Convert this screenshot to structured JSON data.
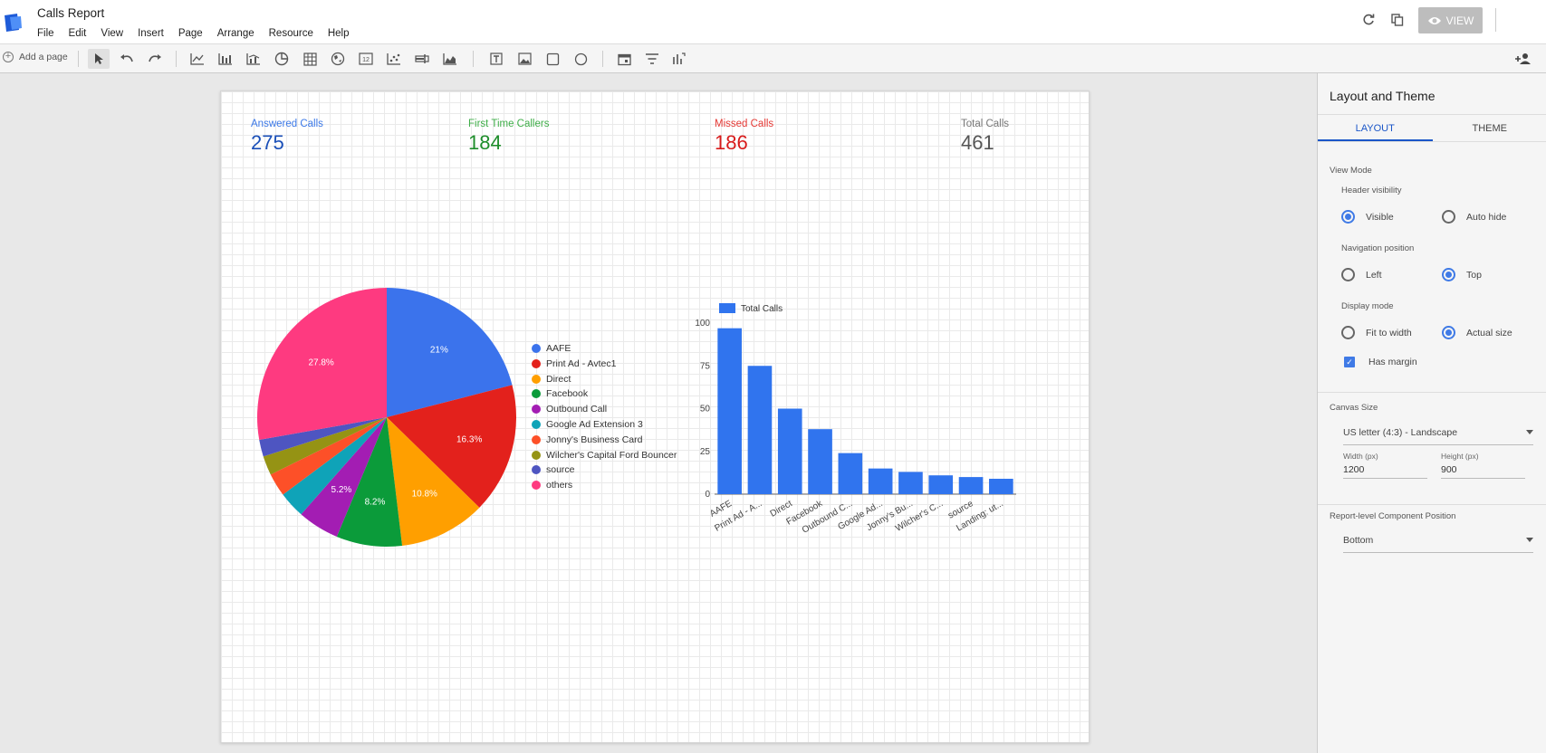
{
  "header": {
    "title": "Calls Report",
    "menu": [
      "File",
      "Edit",
      "View",
      "Insert",
      "Page",
      "Arrange",
      "Resource",
      "Help"
    ],
    "view_label": "VIEW"
  },
  "toolbar": {
    "add_page": "Add a page"
  },
  "kpis": [
    {
      "label": "Answered Calls",
      "value": "275",
      "color": "#3b78e7",
      "value_color": "#1a4fb8"
    },
    {
      "label": "First Time Callers",
      "value": "184",
      "color": "#3fae49",
      "value_color": "#1e8e2b"
    },
    {
      "label": "Missed Calls",
      "value": "186",
      "color": "#e53935",
      "value_color": "#d81b1b"
    },
    {
      "label": "Total Calls",
      "value": "461",
      "color": "#777777",
      "value_color": "#555555"
    }
  ],
  "chart_data": [
    {
      "type": "pie",
      "slices": [
        {
          "name": "AAFE",
          "value": 21.0,
          "label": "21%",
          "color": "#3b73ec"
        },
        {
          "name": "Print Ad - Avtec1",
          "value": 16.3,
          "label": "16.3%",
          "color": "#e3211c"
        },
        {
          "name": "Direct",
          "value": 10.8,
          "label": "10.8%",
          "color": "#ff9f00"
        },
        {
          "name": "Facebook",
          "value": 8.2,
          "label": "8.2%",
          "color": "#0b9b3a"
        },
        {
          "name": "Outbound Call",
          "value": 5.2,
          "label": "5.2%",
          "color": "#a31db3"
        },
        {
          "name": "Google Ad Extension 3",
          "value": 3.3,
          "label": "",
          "color": "#0fa3b8"
        },
        {
          "name": "Jonny's Business Card",
          "value": 2.9,
          "label": "",
          "color": "#fd5028"
        },
        {
          "name": "Wilcher's Capital Ford Bouncer",
          "value": 2.4,
          "label": "",
          "color": "#959314"
        },
        {
          "name": "source",
          "value": 2.1,
          "label": "",
          "color": "#4e55c1"
        },
        {
          "name": "others",
          "value": 27.8,
          "label": "27.8%",
          "color": "#fe3a80"
        }
      ]
    },
    {
      "type": "bar",
      "legend": "Total Calls",
      "color": "#3074ee",
      "categories": [
        "AAFE",
        "Print Ad - A...",
        "Direct",
        "Facebook",
        "Outbound C...",
        "Google Ad...",
        "Jonny's Bu...",
        "Wilcher's C...",
        "source",
        "Landing: ut..."
      ],
      "values": [
        97,
        75,
        50,
        38,
        24,
        15,
        13,
        11,
        10,
        9
      ],
      "yticks": [
        0,
        25,
        50,
        75,
        100
      ],
      "ylim": [
        0,
        100
      ]
    }
  ],
  "panel": {
    "title": "Layout and Theme",
    "tabs": [
      "LAYOUT",
      "THEME"
    ],
    "view_mode": "View Mode",
    "header_visibility": "Header visibility",
    "hv_options": [
      "Visible",
      "Auto hide"
    ],
    "nav_position": "Navigation position",
    "nav_options": [
      "Left",
      "Top"
    ],
    "display_mode": "Display mode",
    "dm_options": [
      "Fit to width",
      "Actual size"
    ],
    "has_margin": "Has margin",
    "canvas_size": "Canvas Size",
    "canvas_select": "US letter (4:3) - Landscape",
    "width_label": "Width (px)",
    "width_value": "1200",
    "height_label": "Height (px)",
    "height_value": "900",
    "component_position": "Report-level Component Position",
    "position_select": "Bottom"
  }
}
